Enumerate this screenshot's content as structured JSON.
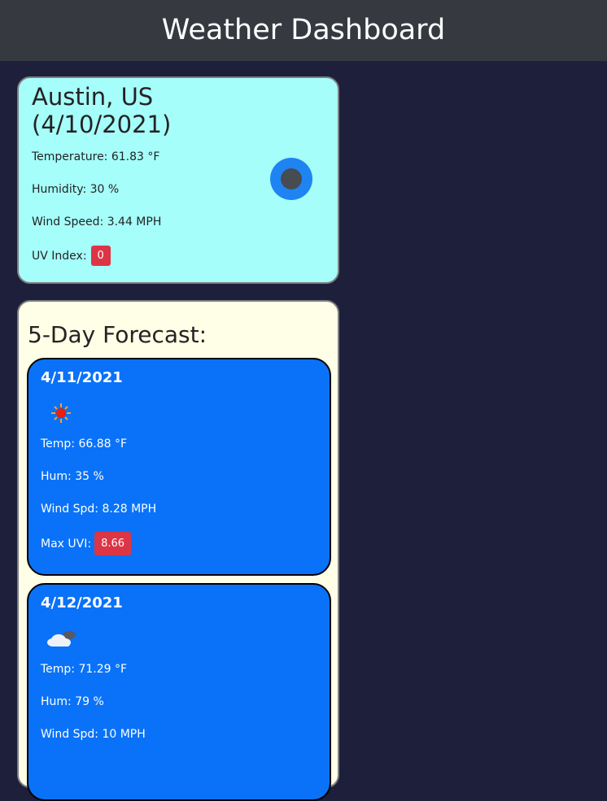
{
  "header": {
    "title": "Weather Dashboard"
  },
  "current": {
    "city_line": "Austin, US",
    "date_line": "(4/10/2021)",
    "temperature": "Temperature: 61.83 °F",
    "humidity": "Humidity: 30 %",
    "wind": "Wind Speed: 3.44 MPH",
    "uv_label": "UV Index:",
    "uv_value": "0",
    "icon": "dark-circle-weather-icon"
  },
  "forecast": {
    "title": "5-Day Forecast:",
    "days": [
      {
        "date": "4/11/2021",
        "icon": "sun-icon",
        "temp": "Temp: 66.88 °F",
        "hum": "Hum: 35 %",
        "wind": "Wind Spd: 8.28 MPH",
        "uvi_label": "Max UVI:",
        "uvi_value": "8.66"
      },
      {
        "date": "4/12/2021",
        "icon": "cloud-icon",
        "temp": "Temp: 71.29 °F",
        "hum": "Hum: 79 %",
        "wind": "Wind Spd: 10 MPH"
      }
    ]
  },
  "colors": {
    "background": "#1e1f3a",
    "header": "#363a40",
    "current_card": "#a5fefa",
    "forecast_panel": "#fffee6",
    "day_card": "#0a72f8",
    "uv_badge": "#dc3545"
  }
}
